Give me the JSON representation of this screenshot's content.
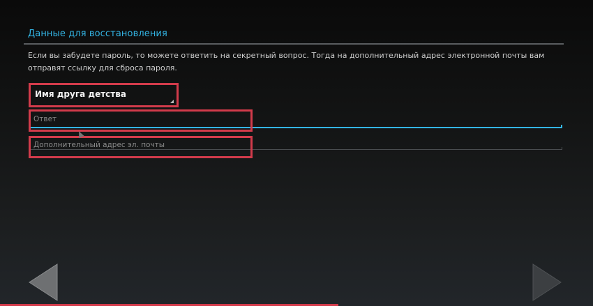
{
  "section": {
    "title": "Данные для восстановления",
    "description": "Если вы забудете пароль, то можете ответить на секретный вопрос. Тогда на дополнительный адрес электронной почты вам отправят ссылку для сброса пароля."
  },
  "form": {
    "question": {
      "selected": "Имя друга детства"
    },
    "answer": {
      "placeholder": "Ответ",
      "value": ""
    },
    "email": {
      "placeholder": "Дополнительный адрес эл. почты",
      "value": ""
    }
  },
  "navigation": {
    "back_icon": "triangle-left-icon",
    "next_icon": "triangle-right-icon"
  },
  "progress": {
    "fraction": 0.57
  },
  "colors": {
    "accent": "#33b5e5",
    "highlight": "#d23b4b",
    "background": "#151617"
  }
}
